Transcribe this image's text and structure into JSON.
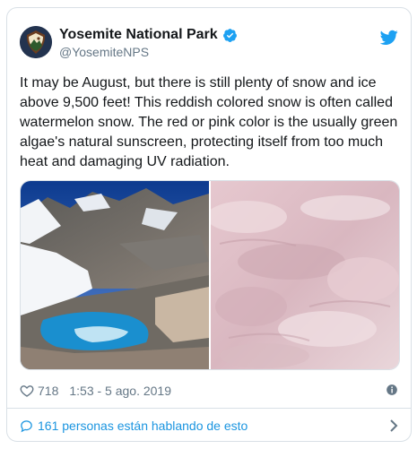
{
  "tweet": {
    "author": {
      "display_name": "Yosemite National Park",
      "handle": "@YosemiteNPS",
      "verified": true,
      "avatar_icon": "nps-arrowhead-logo"
    },
    "platform_icon": "twitter-bird-icon",
    "text": "It may be August, but there is still plenty of snow and ice above 9,500 feet! This reddish colored snow is often called watermelon snow. The red or pink color is the usually green algae's natural sunscreen, protecting itself from too much heat and damaging UV radiation.",
    "media": [
      {
        "icon": "mountain-lake-snow-photo"
      },
      {
        "icon": "pink-watermelon-snow-photo"
      }
    ],
    "likes": "718",
    "timestamp": "1:53 - 5 ago. 2019",
    "conversation_text": "161 personas están hablando de esto"
  },
  "colors": {
    "link": "#1b95e0",
    "text": "#14171a",
    "muted": "#657786",
    "border": "#d9e0e6"
  }
}
